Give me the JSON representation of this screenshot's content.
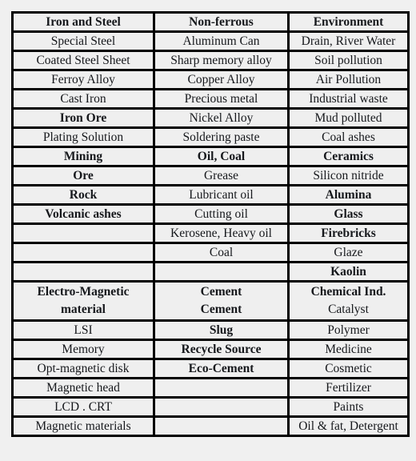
{
  "table": {
    "headers": [
      "Iron and Steel",
      "Non-ferrous",
      "Environment"
    ],
    "rows": [
      {
        "cells": [
          {
            "text": "Special Steel",
            "bold": false
          },
          {
            "text": "Aluminum Can",
            "bold": false
          },
          {
            "text": "Drain, River Water",
            "bold": false
          }
        ]
      },
      {
        "cells": [
          {
            "text": "Coated Steel Sheet",
            "bold": false
          },
          {
            "text": "Sharp memory alloy",
            "bold": false
          },
          {
            "text": "Soil pollution",
            "bold": false
          }
        ]
      },
      {
        "cells": [
          {
            "text": "Ferroy Alloy",
            "bold": false
          },
          {
            "text": "Copper Alloy",
            "bold": false
          },
          {
            "text": "Air Pollution",
            "bold": false
          }
        ]
      },
      {
        "cells": [
          {
            "text": "Cast Iron",
            "bold": false
          },
          {
            "text": "Precious metal",
            "bold": false
          },
          {
            "text": "Industrial waste",
            "bold": false
          }
        ]
      },
      {
        "cells": [
          {
            "text": "Iron Ore",
            "bold": true
          },
          {
            "text": "Nickel Alloy",
            "bold": false
          },
          {
            "text": "Mud polluted",
            "bold": false
          }
        ]
      },
      {
        "cells": [
          {
            "text": "Plating Solution",
            "bold": false
          },
          {
            "text": "Soldering paste",
            "bold": false
          },
          {
            "text": "Coal ashes",
            "bold": false
          }
        ]
      },
      {
        "cells": [
          {
            "text": "Mining",
            "bold": true
          },
          {
            "text": "Oil, Coal",
            "bold": true
          },
          {
            "text": "Ceramics",
            "bold": true
          }
        ]
      },
      {
        "cells": [
          {
            "text": "Ore",
            "bold": true
          },
          {
            "text": "Grease",
            "bold": false
          },
          {
            "text": "Silicon nitride",
            "bold": false
          }
        ]
      },
      {
        "cells": [
          {
            "text": "Rock",
            "bold": true
          },
          {
            "text": "Lubricant oil",
            "bold": false
          },
          {
            "text": "Alumina",
            "bold": true
          }
        ]
      },
      {
        "cells": [
          {
            "text": "Volcanic ashes",
            "bold": true
          },
          {
            "text": "Cutting oil",
            "bold": false
          },
          {
            "text": "Glass",
            "bold": true
          }
        ]
      },
      {
        "cells": [
          {
            "text": "",
            "bold": false
          },
          {
            "text": "Kerosene, Heavy oil",
            "bold": false
          },
          {
            "text": "Firebricks",
            "bold": true
          }
        ]
      },
      {
        "cells": [
          {
            "text": "",
            "bold": false
          },
          {
            "text": "Coal",
            "bold": false
          },
          {
            "text": "Glaze",
            "bold": false
          }
        ]
      },
      {
        "cells": [
          {
            "text": "",
            "bold": false
          },
          {
            "text": "",
            "bold": false
          },
          {
            "text": "Kaolin",
            "bold": true
          }
        ]
      },
      {
        "tall": true,
        "cells": [
          {
            "lines": [
              {
                "text": "Electro-Magnetic",
                "bold": true
              },
              {
                "text": "material",
                "bold": true
              }
            ]
          },
          {
            "lines": [
              {
                "text": "Cement",
                "bold": true
              },
              {
                "text": "Cement",
                "bold": true
              }
            ]
          },
          {
            "lines": [
              {
                "text": "Chemical Ind.",
                "bold": true
              },
              {
                "text": "Catalyst",
                "bold": false
              }
            ]
          }
        ]
      },
      {
        "cells": [
          {
            "text": "LSI",
            "bold": false
          },
          {
            "text": "Slug",
            "bold": true
          },
          {
            "text": "Polymer",
            "bold": false
          }
        ]
      },
      {
        "cells": [
          {
            "text": "Memory",
            "bold": false
          },
          {
            "text": "Recycle Source",
            "bold": true
          },
          {
            "text": "Medicine",
            "bold": false
          }
        ]
      },
      {
        "cells": [
          {
            "text": "Opt-magnetic disk",
            "bold": false
          },
          {
            "text": "Eco-Cement",
            "bold": true
          },
          {
            "text": "Cosmetic",
            "bold": false
          }
        ]
      },
      {
        "cells": [
          {
            "text": "Magnetic head",
            "bold": false
          },
          {
            "text": "",
            "bold": false
          },
          {
            "text": "Fertilizer",
            "bold": false
          }
        ]
      },
      {
        "cells": [
          {
            "text": "LCD . CRT",
            "bold": false
          },
          {
            "text": "",
            "bold": false
          },
          {
            "text": "Paints",
            "bold": false
          }
        ]
      },
      {
        "cells": [
          {
            "text": "Magnetic materials",
            "bold": false
          },
          {
            "text": "",
            "bold": false
          },
          {
            "text": "Oil & fat, Detergent",
            "bold": false
          }
        ]
      }
    ]
  },
  "colors": {
    "page_background": "#f0f0f0",
    "cell_background": "#efefef",
    "border": "#000000",
    "text": "#16181c"
  }
}
